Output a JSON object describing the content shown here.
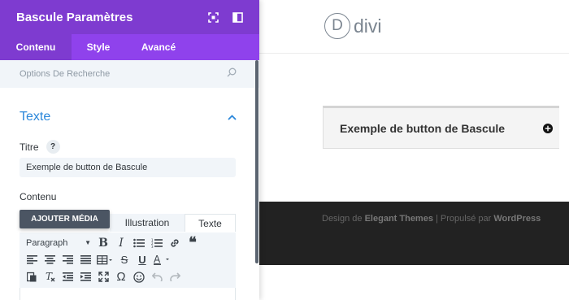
{
  "panel": {
    "title": "Bascule Paramètres",
    "colors": {
      "header": "#7e3bd0",
      "tabs": "#8f42ec",
      "accent": "#2b87da"
    },
    "header_icons": [
      "expand-icon",
      "sidebar-layout-icon"
    ],
    "tabs": [
      {
        "label": "Contenu",
        "active": true
      },
      {
        "label": "Style",
        "active": false
      },
      {
        "label": "Avancé",
        "active": false
      }
    ],
    "search": {
      "placeholder": "Options De Recherche"
    },
    "section": {
      "title": "Texte",
      "expanded": true
    },
    "titre": {
      "label": "Titre",
      "help": "?",
      "value": "Exemple de button de Bascule"
    },
    "contenu": {
      "label": "Contenu",
      "add_media": "AJOUTER MÉDIA",
      "editor_tabs": [
        "Illustration",
        "Texte"
      ],
      "format_select": "Paragraph"
    }
  },
  "preview": {
    "logo_letter": "D",
    "logo_text": "divi",
    "toggle_title": "Exemple de button de Bascule",
    "footer": {
      "prefix": "Design de ",
      "brand": "Elegant Themes",
      "sep": " | Propulsé par ",
      "platform": "WordPress"
    }
  }
}
